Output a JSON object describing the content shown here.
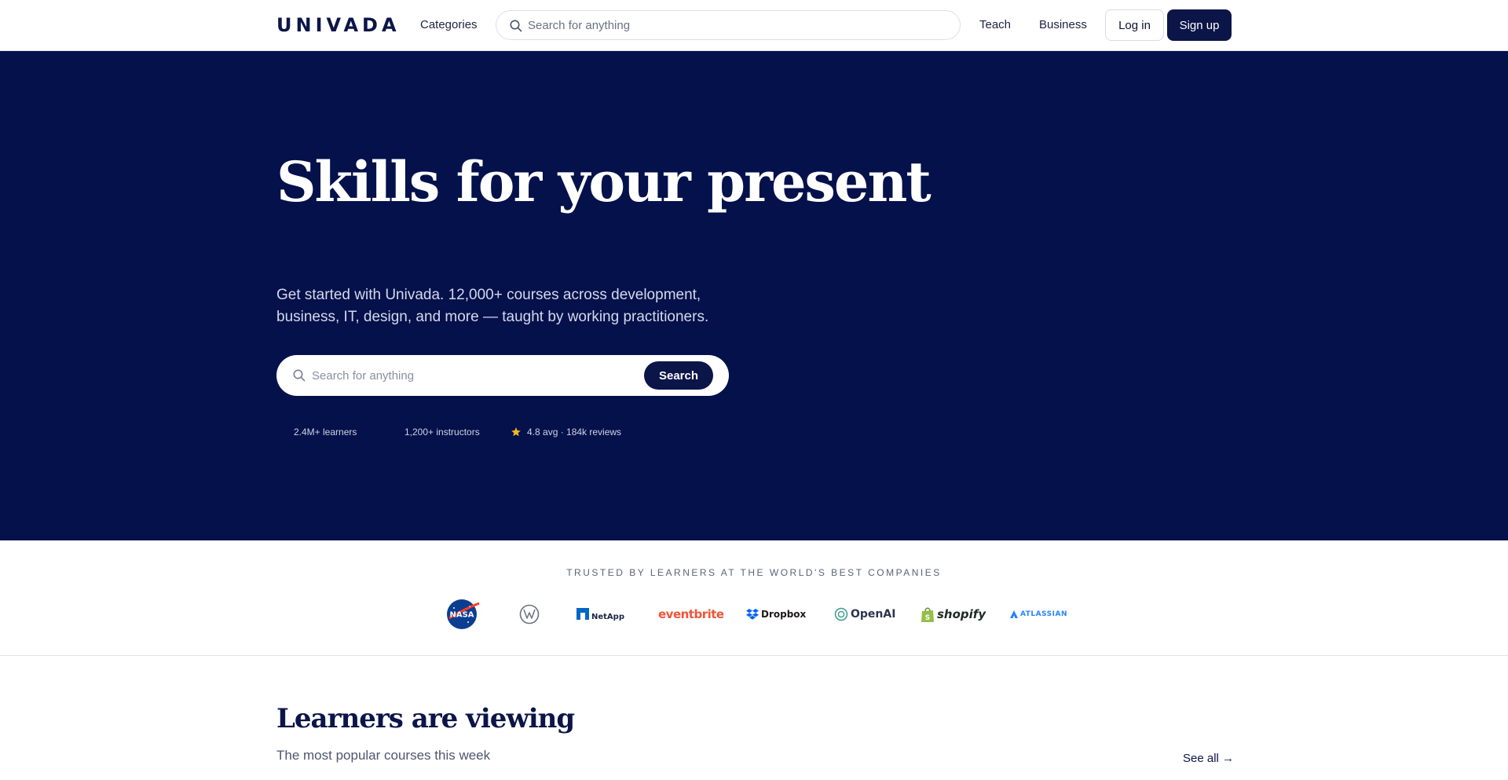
{
  "header": {
    "logo": "UNIVADA",
    "categories": "Categories",
    "search_placeholder": "Search for anything",
    "teach": "Teach",
    "business": "Business",
    "login": "Log in",
    "signup": "Sign up",
    "icons": [
      "search-icon"
    ]
  },
  "hero": {
    "title": "Skills for your present",
    "subtitle_line1": "Get started with Univada. 12,000+ courses across development,",
    "subtitle_line2": "business, IT, design, and more — taught by working practitioners.",
    "search_placeholder": "Search for anything",
    "search_button": "Search",
    "stats": {
      "learners": "2.4M+ learners",
      "instructors": "1,200+ instructors",
      "rating": "4.8 avg · 184k reviews"
    },
    "background_color": "#04114b",
    "icons": [
      "search-icon",
      "star-icon"
    ]
  },
  "trusted": {
    "label": "TRUSTED BY LEARNERS AT THE WORLD'S BEST COMPANIES",
    "logos": {
      "nasa": "NASA",
      "netapp": "NetApp",
      "eventbrite": "eventbrite",
      "dropbox": "Dropbox",
      "openai": "OpenAI",
      "shopify": "shopify",
      "atlassian": "ATLASSIAN"
    }
  },
  "section": {
    "title": "Learners are viewing",
    "subtitle": "The most popular courses this week",
    "see_all": "See all →"
  },
  "colors": {
    "brand_navy": "#0b1548",
    "eventbrite": "#f05537",
    "dropbox": "#0061fe",
    "shopify": "#95bf47",
    "atlassian": "#2684ff",
    "netapp": "#0067c5",
    "star": "#f5b623"
  }
}
